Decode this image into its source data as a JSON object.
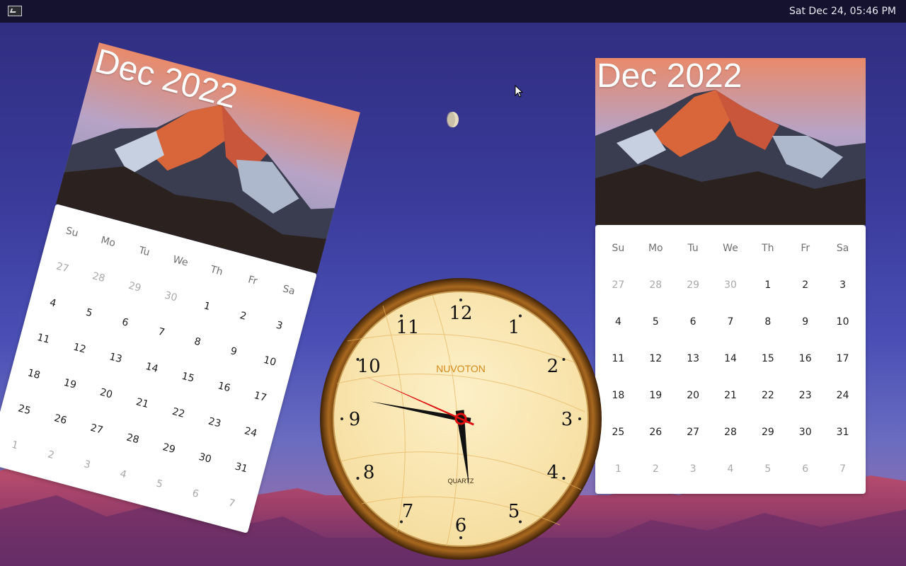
{
  "topbar": {
    "terminal_icon": "terminal-icon",
    "datetime": "Sat Dec 24, 05:46 PM"
  },
  "calendar_left": {
    "title": "Dec 2022",
    "weekdays": [
      "Su",
      "Mo",
      "Tu",
      "We",
      "Th",
      "Fr",
      "Sa"
    ],
    "days": [
      {
        "d": "27",
        "m": true
      },
      {
        "d": "28",
        "m": true
      },
      {
        "d": "29",
        "m": true
      },
      {
        "d": "30",
        "m": true
      },
      {
        "d": "1"
      },
      {
        "d": "2"
      },
      {
        "d": "3"
      },
      {
        "d": "4"
      },
      {
        "d": "5"
      },
      {
        "d": "6"
      },
      {
        "d": "7"
      },
      {
        "d": "8"
      },
      {
        "d": "9"
      },
      {
        "d": "10"
      },
      {
        "d": "11"
      },
      {
        "d": "12"
      },
      {
        "d": "13"
      },
      {
        "d": "14"
      },
      {
        "d": "15"
      },
      {
        "d": "16"
      },
      {
        "d": "17"
      },
      {
        "d": "18"
      },
      {
        "d": "19"
      },
      {
        "d": "20"
      },
      {
        "d": "21"
      },
      {
        "d": "22"
      },
      {
        "d": "23"
      },
      {
        "d": "24"
      },
      {
        "d": "25"
      },
      {
        "d": "26"
      },
      {
        "d": "27"
      },
      {
        "d": "28"
      },
      {
        "d": "29"
      },
      {
        "d": "30"
      },
      {
        "d": "31"
      },
      {
        "d": "1",
        "m": true
      },
      {
        "d": "2",
        "m": true
      },
      {
        "d": "3",
        "m": true
      },
      {
        "d": "4",
        "m": true
      },
      {
        "d": "5",
        "m": true
      },
      {
        "d": "6",
        "m": true
      },
      {
        "d": "7",
        "m": true
      }
    ]
  },
  "calendar_right": {
    "title": "Dec 2022",
    "weekdays": [
      "Su",
      "Mo",
      "Tu",
      "We",
      "Th",
      "Fr",
      "Sa"
    ],
    "days": [
      {
        "d": "27",
        "m": true
      },
      {
        "d": "28",
        "m": true
      },
      {
        "d": "29",
        "m": true
      },
      {
        "d": "30",
        "m": true
      },
      {
        "d": "1"
      },
      {
        "d": "2"
      },
      {
        "d": "3"
      },
      {
        "d": "4"
      },
      {
        "d": "5"
      },
      {
        "d": "6"
      },
      {
        "d": "7"
      },
      {
        "d": "8"
      },
      {
        "d": "9"
      },
      {
        "d": "10"
      },
      {
        "d": "11"
      },
      {
        "d": "12"
      },
      {
        "d": "13"
      },
      {
        "d": "14"
      },
      {
        "d": "15"
      },
      {
        "d": "16"
      },
      {
        "d": "17"
      },
      {
        "d": "18"
      },
      {
        "d": "19"
      },
      {
        "d": "20"
      },
      {
        "d": "21"
      },
      {
        "d": "22"
      },
      {
        "d": "23"
      },
      {
        "d": "24"
      },
      {
        "d": "25"
      },
      {
        "d": "26"
      },
      {
        "d": "27"
      },
      {
        "d": "28"
      },
      {
        "d": "29"
      },
      {
        "d": "30"
      },
      {
        "d": "31"
      },
      {
        "d": "1",
        "m": true
      },
      {
        "d": "2",
        "m": true
      },
      {
        "d": "3",
        "m": true
      },
      {
        "d": "4",
        "m": true
      },
      {
        "d": "5",
        "m": true
      },
      {
        "d": "6",
        "m": true
      },
      {
        "d": "7",
        "m": true
      }
    ]
  },
  "analog_clock": {
    "brand": "NUVOTON",
    "label": "QUARTZ",
    "numerals": [
      "12",
      "1",
      "2",
      "3",
      "4",
      "5",
      "6",
      "7",
      "8",
      "9",
      "10",
      "11"
    ],
    "hour": 5,
    "minute": 46,
    "second": 49,
    "colors": {
      "rim": "#7a4a12",
      "face": "#fbe8b4",
      "brand": "#d58a1a",
      "second_hand": "#e01010",
      "hands": "#111111"
    }
  },
  "desktop": {
    "moon_icon": "moon-icon",
    "cursor_icon": "mouse-pointer-icon"
  }
}
